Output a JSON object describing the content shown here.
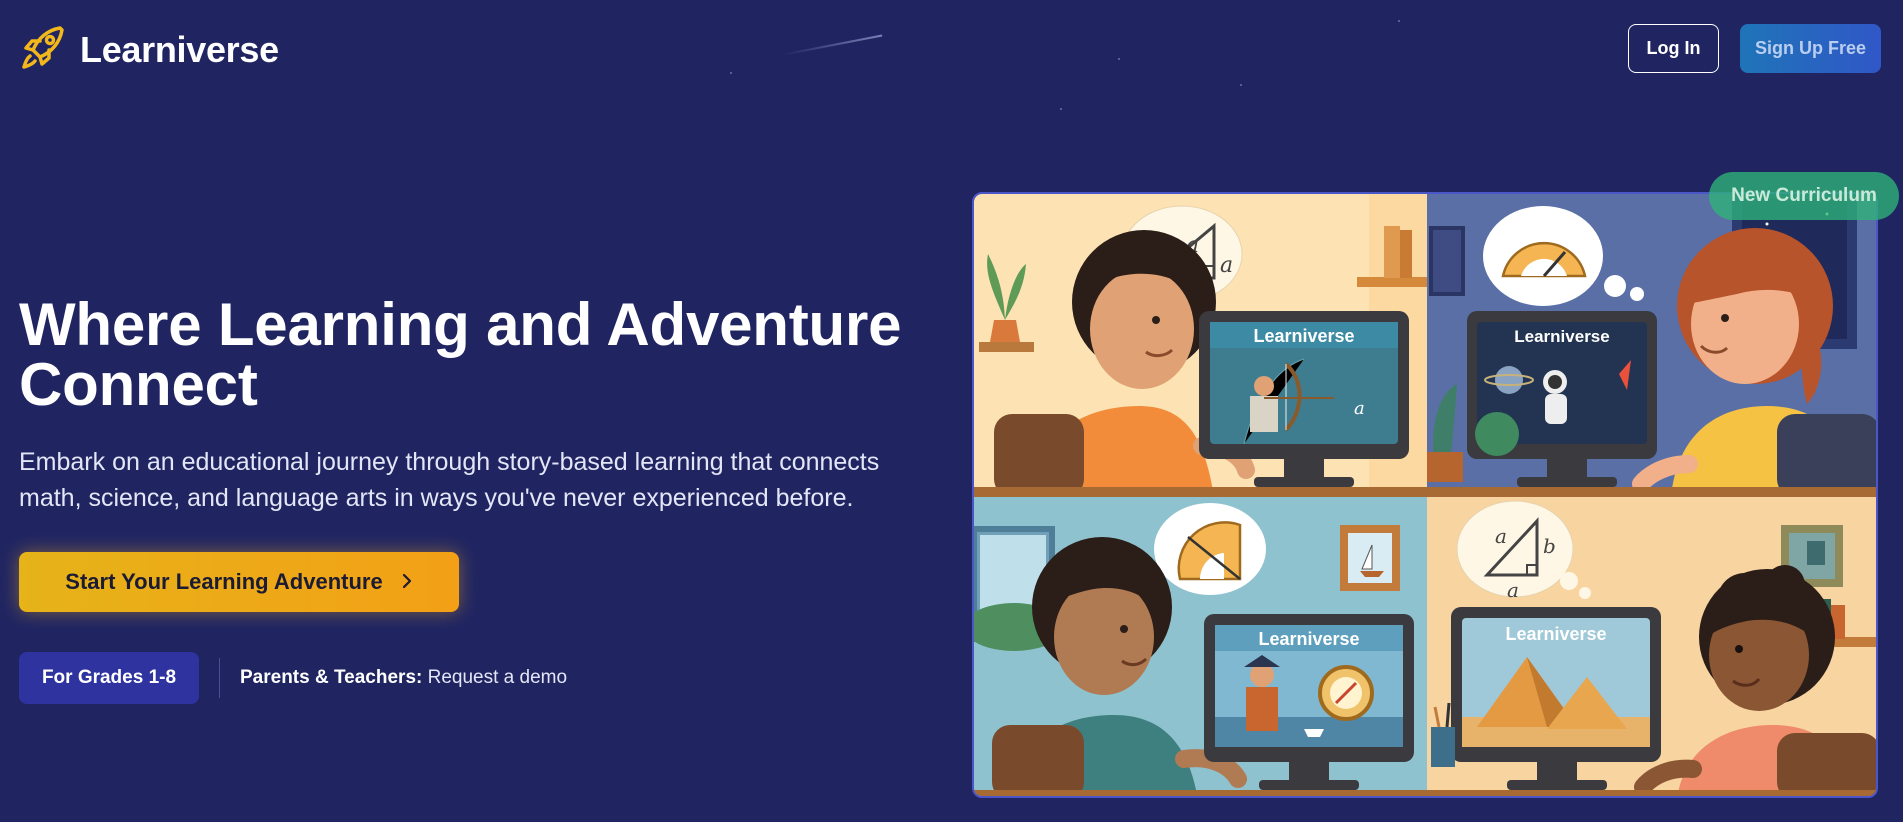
{
  "brand": {
    "name": "Learniverse",
    "icon": "rocket-icon",
    "icon_color": "#f2b81b"
  },
  "header": {
    "login_label": "Log In",
    "signup_label": "Sign Up Free"
  },
  "hero": {
    "title": "Where Learning and Adventure Connect",
    "subtitle": "Embark on an educational journey through story-based learning that connects math, science, and language arts in ways you've never experienced before.",
    "cta_label": "Start Your Learning Adventure",
    "cta_icon": "chevron-right-icon",
    "grades_badge": "For Grades 1-8",
    "demo_bold": "Parents & Teachers:",
    "demo_text": "Request a demo"
  },
  "illustration": {
    "badge": "New Curriculum",
    "screens": [
      {
        "screen_title": "Learniverse",
        "thought": "right-triangle",
        "labels": [
          "a",
          "a",
          "a"
        ]
      },
      {
        "screen_title": "Learniverse",
        "thought": "protractor"
      },
      {
        "screen_title": "Learniverse",
        "thought": "protractor"
      },
      {
        "screen_title": "Learniverse",
        "thought": "right-triangle",
        "labels": [
          "a",
          "b",
          "a"
        ]
      }
    ]
  },
  "colors": {
    "background": "#202562",
    "accent": "#f2b81b",
    "signup": "#2a63c2",
    "badge": "#2eb478"
  }
}
